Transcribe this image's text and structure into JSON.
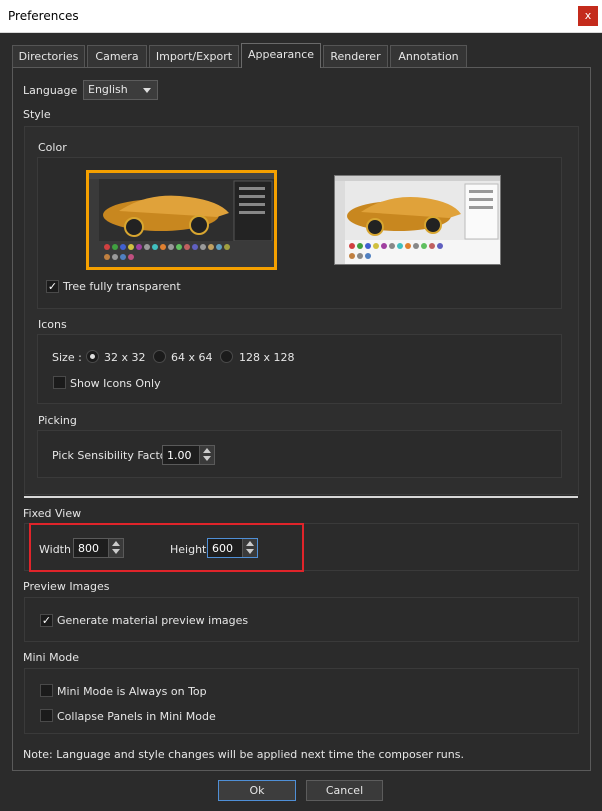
{
  "window": {
    "title": "Preferences",
    "close_label": "x"
  },
  "tabs": [
    {
      "label": "Directories",
      "active": false
    },
    {
      "label": "Camera",
      "active": false
    },
    {
      "label": "Import/Export",
      "active": false
    },
    {
      "label": "Appearance",
      "active": true
    },
    {
      "label": "Renderer",
      "active": false
    },
    {
      "label": "Annotation",
      "active": false
    }
  ],
  "language": {
    "label": "Language",
    "value": "English"
  },
  "style": {
    "heading": "Style",
    "color": {
      "heading": "Color",
      "selected_border_color": "#f5a000",
      "tree_transparent_label": "Tree fully transparent",
      "tree_transparent_checked": true
    },
    "icons": {
      "heading": "Icons",
      "size_label": "Size :",
      "options": [
        "32 x 32",
        "64 x 64",
        "128 x 128"
      ],
      "selected_index": 0,
      "show_icons_only_label": "Show Icons Only",
      "show_icons_only_checked": false
    },
    "picking": {
      "heading": "Picking",
      "pick_sensibility_label": "Pick Sensibility Factor",
      "pick_sensibility_value": "1.00"
    }
  },
  "fixed_view": {
    "heading": "Fixed View",
    "width_label": "Width",
    "width_value": "800",
    "height_label": "Height",
    "height_value": "600",
    "highlight_color": "#e0242a"
  },
  "preview_images": {
    "heading": "Preview Images",
    "generate_label": "Generate material preview images",
    "generate_checked": true
  },
  "mini_mode": {
    "heading": "Mini Mode",
    "always_on_top_label": "Mini Mode is Always on Top",
    "always_on_top_checked": false,
    "collapse_label": "Collapse Panels in Mini Mode",
    "collapse_checked": false
  },
  "note": "Note: Language and style changes will be applied next time the composer runs.",
  "buttons": {
    "ok": "Ok",
    "cancel": "Cancel"
  },
  "colors": {
    "background": "#2b2b2b",
    "accent": "#4f8fd6"
  }
}
